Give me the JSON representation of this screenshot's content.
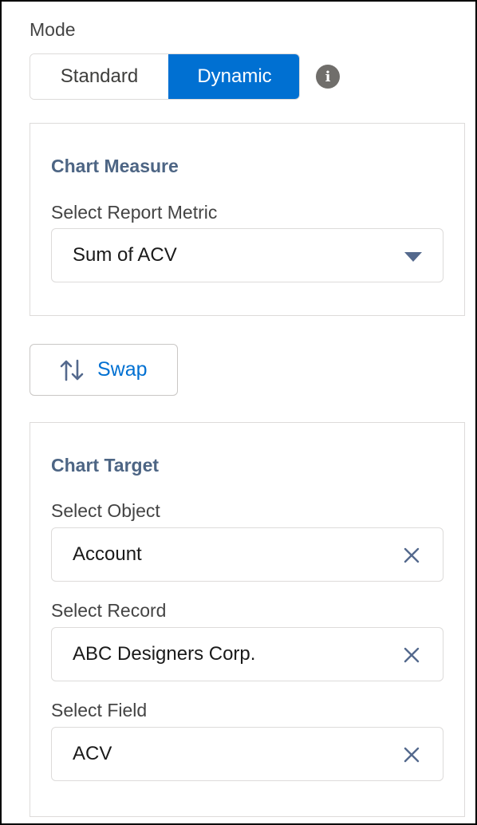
{
  "mode": {
    "label": "Mode",
    "options": [
      "Standard",
      "Dynamic"
    ],
    "selected": "Dynamic",
    "info_icon": "info-icon"
  },
  "chart_measure": {
    "title": "Chart Measure",
    "metric_label": "Select Report Metric",
    "metric_value": "Sum of ACV"
  },
  "swap": {
    "label": "Swap",
    "icon": "swap-arrows-icon"
  },
  "chart_target": {
    "title": "Chart Target",
    "object_label": "Select Object",
    "object_value": "Account",
    "record_label": "Select Record",
    "record_value": "ABC Designers Corp.",
    "field_label": "Select Field",
    "field_value": "ACV"
  },
  "colors": {
    "accent": "#0070d2",
    "card_title": "#4d6584",
    "border": "#dddbda"
  }
}
